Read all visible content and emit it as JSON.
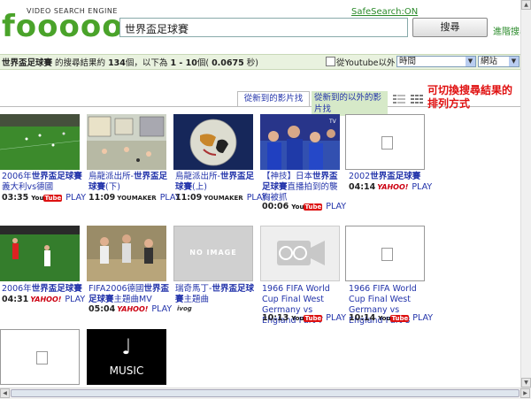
{
  "header": {
    "logo_tagline": "VIDEO SEARCH ENGINE",
    "logo_text": "fooooo",
    "search_value": "世界盃足球賽",
    "safesearch": "SafeSearch:ON",
    "search_button": "搜尋",
    "advanced_link": "進階搜尋"
  },
  "results_bar": {
    "query": "世界盃足球賽",
    "text_mid": " 的搜尋結果約 ",
    "count": "134",
    "text_mid2": "個，以下為 ",
    "range": "1 - 10",
    "text_mid3": "個( ",
    "time": "0.0675",
    "text_end": " 秒)",
    "youtube_filter_label": "從Youtube以外",
    "sort_select": "時間",
    "site_select": "網站"
  },
  "tabs": {
    "tab1": "從新到的影片找",
    "tab2": "從新到的以外的影片找"
  },
  "annotation": "可切換搜尋結果的排列方式",
  "videos": [
    {
      "title_pre": "2006年",
      "title_bold": "世界盃足球賽",
      "title_post": "義大利vs德國",
      "duration": "03:35",
      "source": "YouTube",
      "play": "PLAY"
    },
    {
      "title_pre": "烏龍派出所-",
      "title_bold": "世界盃足球賽",
      "title_post": "(下)",
      "duration": "11:09",
      "source": "YOUMAKER",
      "play": "PLAY"
    },
    {
      "title_pre": "烏龍派出所-",
      "title_bold": "世界盃足球賽",
      "title_post": "(上)",
      "duration": "11:09",
      "source": "YOUMAKER",
      "play": "PLAY"
    },
    {
      "title_pre": "【神技】日本",
      "title_bold": "世界盃足球賽",
      "title_post": "直播拍到的襲胸被抓",
      "duration": "00:06",
      "source": "YouTube",
      "play": "PLAY"
    },
    {
      "title_pre": "2002",
      "title_bold": "世界盃足球賽",
      "title_post": "",
      "duration": "04:14",
      "source": "YAHOO!",
      "play": "PLAY"
    },
    {
      "title_pre": "2006年",
      "title_bold": "世界盃足球賽",
      "title_post": "",
      "duration": "04:31",
      "source": "YAHOO!",
      "play": "PLAY"
    },
    {
      "title_pre": "FIFA2006德國",
      "title_bold": "世界盃足球賽",
      "title_post": "主題曲MV",
      "duration": "05:04",
      "source": "YAHOO!",
      "play": "PLAY"
    },
    {
      "title_pre": "瑞奇馬丁-",
      "title_bold": "世界盃足球賽",
      "title_post": "主題曲",
      "duration": "",
      "source": "ivog",
      "play": ""
    },
    {
      "title_pre": "1966 FIFA World Cup Final West Germany vs England Part 7",
      "title_bold": "",
      "title_post": "",
      "duration": "10:13",
      "source": "YouTube",
      "play": "PLAY"
    },
    {
      "title_pre": "1966 FIFA World Cup Final West Germany vs England Part 8",
      "title_bold": "",
      "title_post": "",
      "duration": "10:14",
      "source": "YouTube",
      "play": "PLAY"
    }
  ],
  "no_image_label": "NO IMAGE",
  "music_label": "MUSIC",
  "colors": {
    "logo_green": "#4aa32a",
    "link_blue": "#2233aa",
    "annotation_red": "#e01010",
    "results_bar_bg": "#e9f2df"
  }
}
